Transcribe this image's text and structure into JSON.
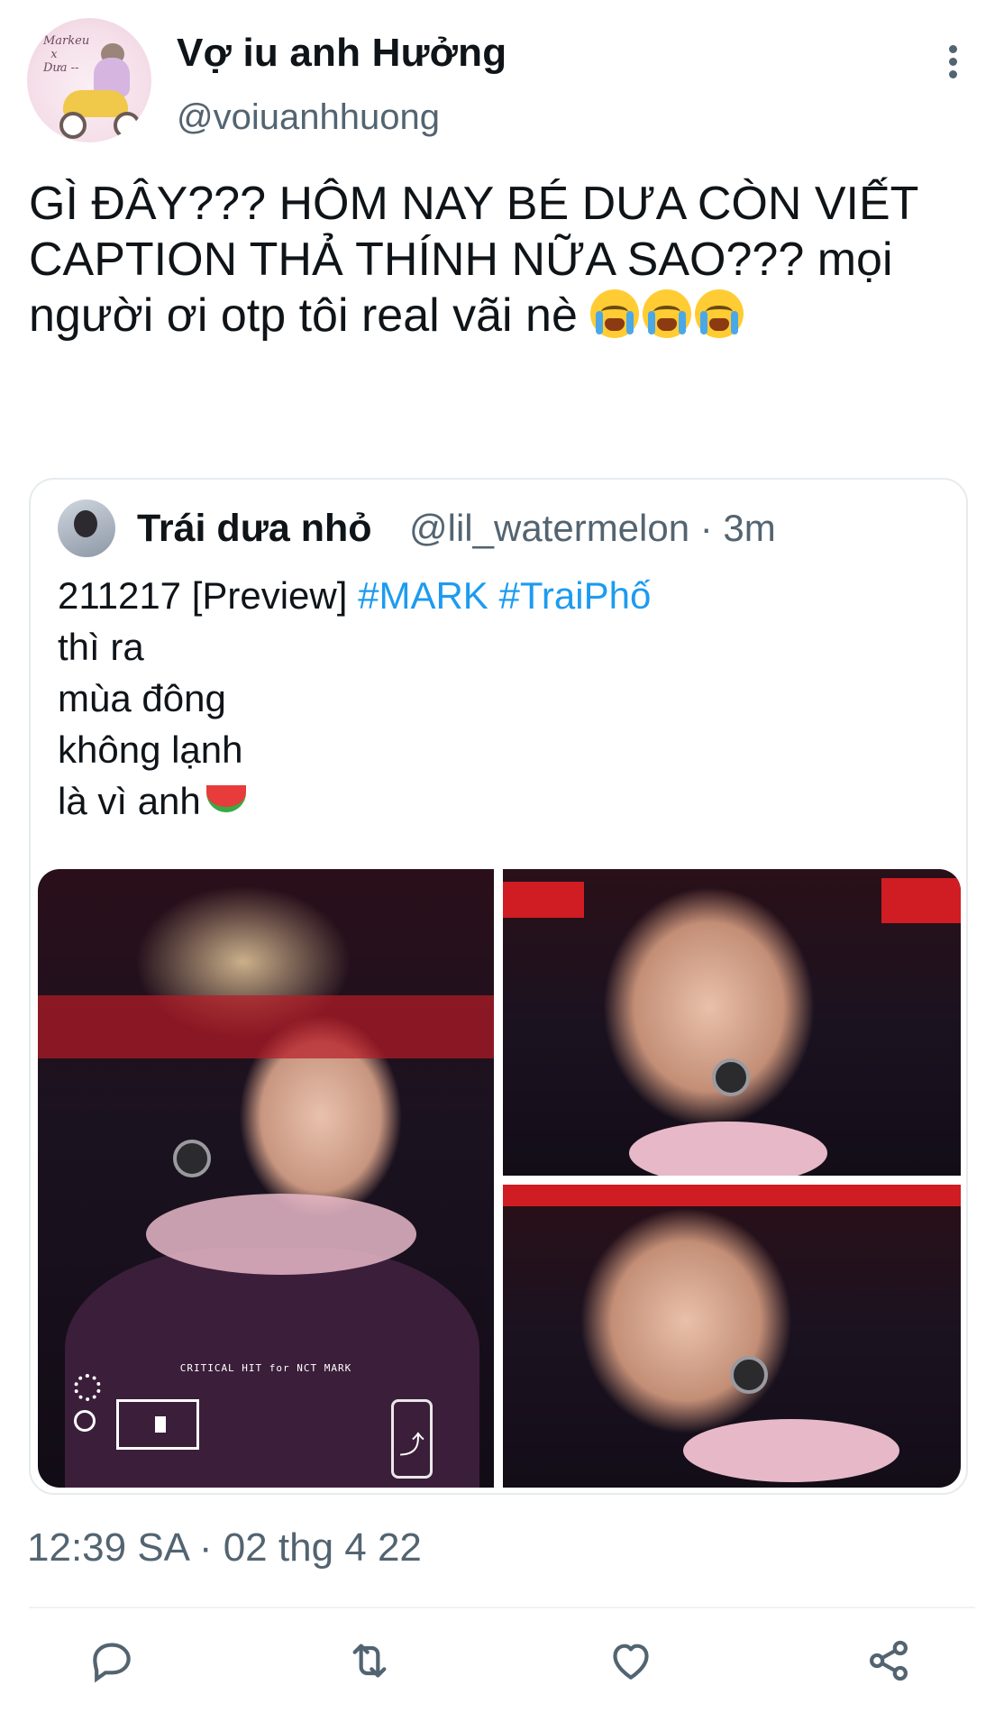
{
  "tweet": {
    "display_name": "Vợ iu anh Hưởng",
    "handle": "@voiuanhhuong",
    "text": "GÌ ĐÂY??? HÔM NAY BÉ DƯA CÒN VIẾT CAPTION THẢ THÍNH NỮA SAO??? mọi người ơi otp tôi real vãi nè",
    "timestamp": "12:39 SA · 02 thg 4 22",
    "avatar_text": "Markeu x Dưa --"
  },
  "quoted_tweet": {
    "display_name": "Trái dưa nhỏ",
    "handle_time": "@lil_watermelon · 3m",
    "line1_prefix": "211217 [Preview] ",
    "hashtag1": "#MARK",
    "hashtag2": "#TraiPhố",
    "line2": "thì ra",
    "line3": "mùa đông",
    "line4": "không lạnh",
    "line5": "là vì anh",
    "photo_watermark": "CRITICAL HIT for NCT MARK"
  },
  "colors": {
    "text": "#0f1419",
    "secondary": "#536471",
    "link": "#1d9bf0",
    "border": "#e6ebee"
  },
  "icons": {
    "more": "more-vertical-icon",
    "reply": "reply-icon",
    "retweet": "retweet-icon",
    "like": "like-icon",
    "share": "share-icon"
  }
}
